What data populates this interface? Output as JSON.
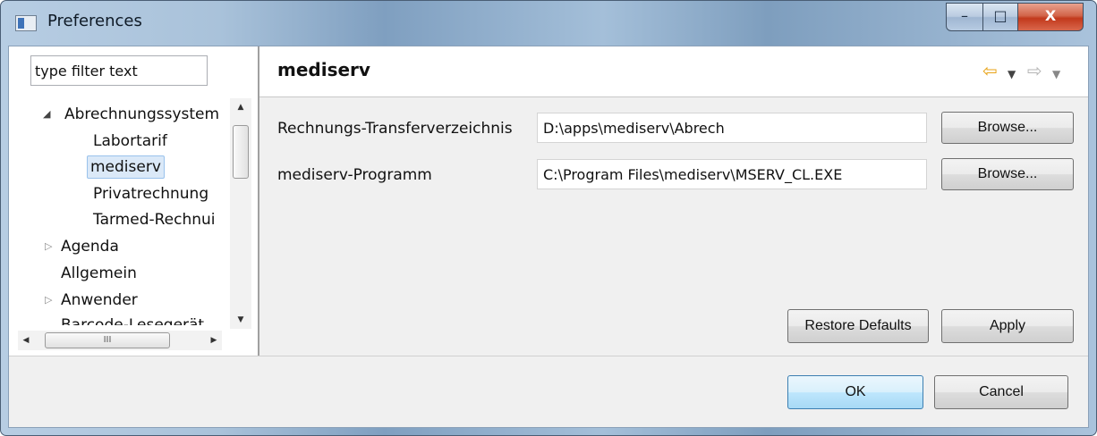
{
  "window": {
    "title": "Preferences",
    "buttons": {
      "minimize": "–",
      "maximize": "□",
      "close": "X"
    }
  },
  "filter": {
    "value": "type filter text"
  },
  "tree": {
    "items": [
      {
        "label": "Abrechnungssystem",
        "expanded": true,
        "level": 0
      },
      {
        "label": "Labortarif",
        "level": 1
      },
      {
        "label": "mediserv",
        "level": 1,
        "selected": true
      },
      {
        "label": "Privatrechnung",
        "level": 1
      },
      {
        "label": "Tarmed-Rechnui",
        "level": 1
      },
      {
        "label": "Agenda",
        "expanded": false,
        "level": 0
      },
      {
        "label": "Allgemein",
        "level": 0
      },
      {
        "label": "Anwender",
        "expanded": false,
        "level": 0
      },
      {
        "label": "Barcode-Lesegerät",
        "level": 0
      }
    ],
    "hscroll_grip": "III"
  },
  "page": {
    "title": "mediserv",
    "fields": [
      {
        "label": "Rechnungs-Transferverzeichnis",
        "value": "D:\\apps\\mediserv\\Abrech",
        "button": "Browse..."
      },
      {
        "label": "mediserv-Programm",
        "value": "C:\\Program Files\\mediserv\\MSERV_CL.EXE",
        "button": "Browse..."
      }
    ],
    "restore_defaults": "Restore Defaults",
    "apply": "Apply"
  },
  "dialog": {
    "ok": "OK",
    "cancel": "Cancel"
  },
  "colors": {
    "nav_back": "#e8a317",
    "nav_forward": "#b5b5b5",
    "selection_bg": "#dbe9f8"
  }
}
